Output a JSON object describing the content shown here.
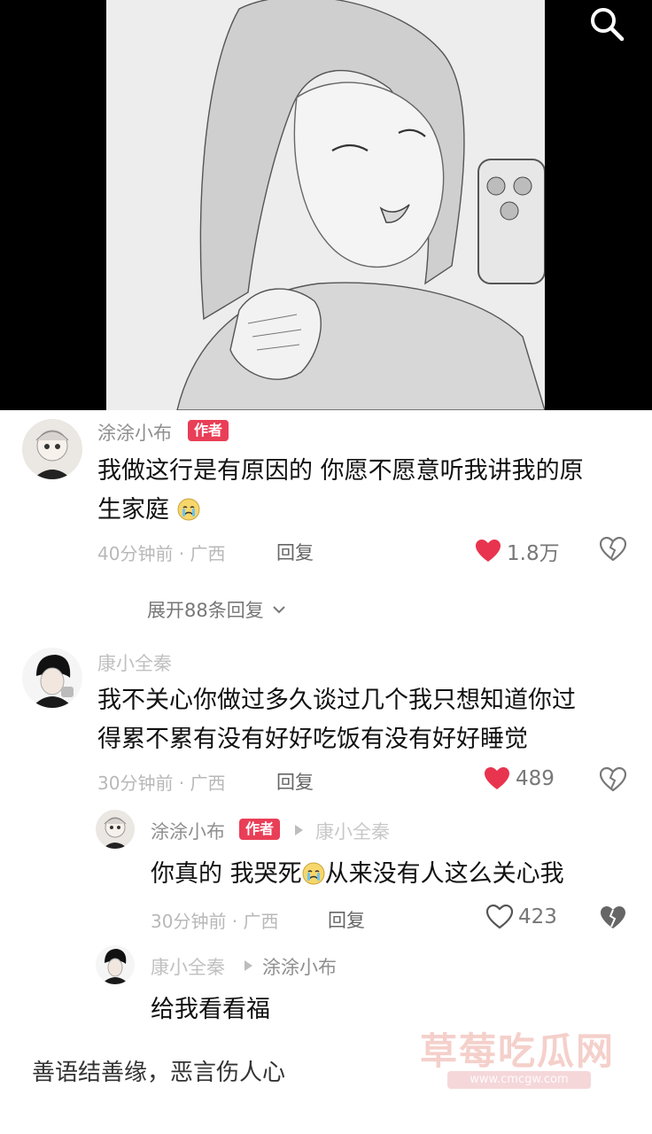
{
  "comments": [
    {
      "author": "涂涂小布",
      "badge": "作者",
      "text_line1": "我做这行是有原因的 你愿不愿意听我讲我的原",
      "text_line2": "生家庭",
      "time_location": "40分钟前 · 广西",
      "reply_label": "回复",
      "likes": "1.8万",
      "liked": true,
      "expand_label": "展开88条回复"
    },
    {
      "author": "康小全秦",
      "text_line1": "我不关心你做过多久谈过几个我只想知道你过",
      "text_line2": "得累不累有没有好好吃饭有没有好好睡觉",
      "time_location": "30分钟前 · 广西",
      "reply_label": "回复",
      "likes": "489",
      "liked": true
    }
  ],
  "replies": [
    {
      "author": "涂涂小布",
      "badge": "作者",
      "reply_to": "康小全秦",
      "text_a": "你真的 我哭死",
      "text_b": "从来没有人这么关心我",
      "time_location": "30分钟前 · 广西",
      "reply_label": "回复",
      "likes": "423",
      "liked": false
    },
    {
      "author": "康小全秦",
      "reply_to": "涂涂小布",
      "text": "给我看看福"
    }
  ],
  "footer_quote": "善语结善缘，恶言伤人心",
  "watermark": {
    "title": "草莓吃瓜网",
    "url": "www.cmcgw.com"
  },
  "colors": {
    "badge": "#e93e57",
    "heart": "#e8344f"
  },
  "icons": [
    "search-icon",
    "heart-icon",
    "broken-heart-icon",
    "crying-emoji-icon",
    "chevron-down-icon"
  ]
}
